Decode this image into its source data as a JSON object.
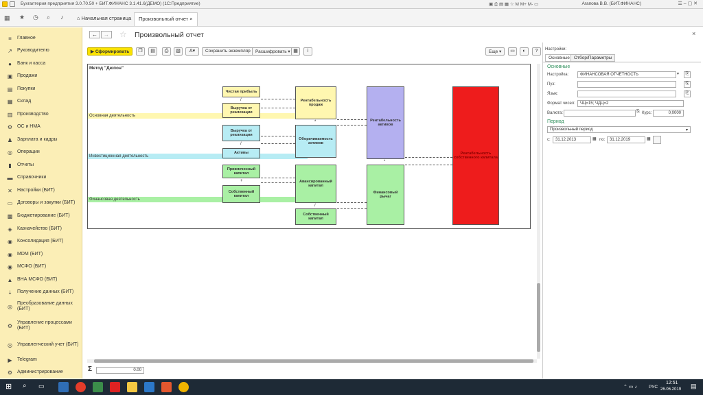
{
  "titlebar": {
    "title": "Бухгалтерия предприятия 3.0.70.50 + БИТ.ФИНАНС 3.1.41.6(ДЕМО)   (1С:Предприятие)",
    "user": "Агапова В.В. (БИТ.ФИНАНС)"
  },
  "tabs": {
    "home": "Начальная страница",
    "report": "Произвольный отчет"
  },
  "sidebar": [
    {
      "label": "Главное",
      "icon": "≡"
    },
    {
      "label": "Руководителю",
      "icon": "↗"
    },
    {
      "label": "Банк и касса",
      "icon": "●"
    },
    {
      "label": "Продажи",
      "icon": "▣"
    },
    {
      "label": "Покупки",
      "icon": "▤"
    },
    {
      "label": "Склад",
      "icon": "▦"
    },
    {
      "label": "Производство",
      "icon": "▥"
    },
    {
      "label": "ОС и НМА",
      "icon": "⚙"
    },
    {
      "label": "Зарплата и кадры",
      "icon": "♟"
    },
    {
      "label": "Операции",
      "icon": "◎"
    },
    {
      "label": "Отчеты",
      "icon": "▮"
    },
    {
      "label": "Справочники",
      "icon": "▬"
    },
    {
      "label": "Настройки (БИТ)",
      "icon": "✕"
    },
    {
      "label": "Договоры и закупки (БИТ)",
      "icon": "▭"
    },
    {
      "label": "Бюджетирование (БИТ)",
      "icon": "▩"
    },
    {
      "label": "Казначейство (БИТ)",
      "icon": "◈"
    },
    {
      "label": "Консолидация (БИТ)",
      "icon": "◉"
    },
    {
      "label": "MDM (БИТ)",
      "icon": "◉"
    },
    {
      "label": "МСФО (БИТ)",
      "icon": "◉"
    },
    {
      "label": "ВНА МСФО (БИТ)",
      "icon": "▲"
    },
    {
      "label": "Получение данных (БИТ)",
      "icon": "⤓"
    },
    {
      "label": "Преобразование данных (БИТ)",
      "icon": "◎"
    },
    {
      "label": "Управление процессами (БИТ)",
      "icon": "⚙"
    },
    {
      "label": "Управленческий учет (БИТ)",
      "icon": "◎"
    },
    {
      "label": "Telegram",
      "icon": "▶"
    },
    {
      "label": "Администрирование",
      "icon": "⚙"
    }
  ],
  "page_title": "Произвольный отчет",
  "toolbar": {
    "generate": "Сформировать",
    "save_variant": "Сохранить экземпляр",
    "decode": "Расшифровать",
    "more": "Еще"
  },
  "report": {
    "title": "Метод \"Дюпон\"",
    "bands": {
      "operating": "Основная деятельность",
      "investing": "Инвестиционная деятельность",
      "financing": "Финансовая деятельность"
    },
    "boxes": {
      "net_profit": "Чистая прибыль",
      "revenue1": "Выручка от реализации",
      "revenue2": "Выручка от реализации",
      "assets": "Активы",
      "borrowed": "Привлеченный капитал",
      "equity1": "Собственный капитал",
      "ros": "Рентабельность продаж",
      "turnover": "Оборачиваемость активов",
      "advanced": "Авансированный капитал",
      "equity2": "Собственный капитал",
      "roa": "Рентабельность активов",
      "leverage": "Финансовый рычаг",
      "roe": "Рентабельность собственного капитала"
    },
    "ops": {
      "div1": "/",
      "div2": "/",
      "div3": "/",
      "mul1": "*",
      "div4": "/",
      "mul2": "*"
    }
  },
  "total": {
    "sigma": "Σ",
    "value": "0.00"
  },
  "settings": {
    "header": "Настройки:",
    "tabs": [
      "Основные",
      "Отбор/Параметры"
    ],
    "section_main": "Основные",
    "setting_label": "Настройка:",
    "setting_value": "ФИНАНСОВАЯ ОТЧЕТНОСТЬ",
    "user_label": "Пуз:",
    "lang_label": "Язык:",
    "format_label": "Формат чисел:",
    "format_value": "ЧЦ=15; ЧДЦ=2",
    "currency_label": "Валюта:",
    "rate_label": "Курс:",
    "rate_value": "0,0000",
    "section_period": "Период",
    "period_value": "Произвольный период",
    "from_label": "с:",
    "from_value": "31.12.2013",
    "to_label": "по:",
    "to_value": "31.12.2019"
  },
  "taskbar": {
    "lang": "РУС",
    "time": "12:51",
    "date": "26.06.2019"
  }
}
